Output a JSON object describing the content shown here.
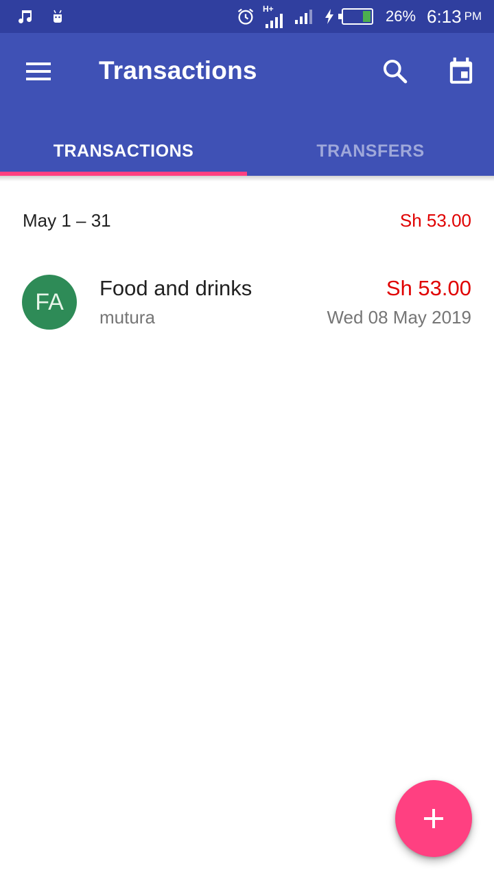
{
  "status_bar": {
    "battery_percent": "26%",
    "battery_level": 0.26,
    "time": "6:13",
    "ampm": "PM",
    "network_type": "H+",
    "icons": [
      "music-note-icon",
      "android-icon",
      "alarm-icon",
      "signal-icon",
      "signal-icon",
      "charging-icon",
      "battery-icon"
    ]
  },
  "app_bar": {
    "title": "Transactions",
    "icons": [
      "menu-icon",
      "search-icon",
      "calendar-icon"
    ]
  },
  "tabs": [
    {
      "label": "TRANSACTIONS",
      "active": true
    },
    {
      "label": "TRANSFERS",
      "active": false
    }
  ],
  "period": {
    "label": "May 1 – 31",
    "total": "Sh 53.00"
  },
  "transactions": [
    {
      "avatar_initials": "FA",
      "category": "Food and drinks",
      "note": "mutura",
      "amount": "Sh 53.00",
      "date": "Wed 08 May 2019"
    }
  ],
  "fab": {
    "icon": "plus-icon"
  },
  "colors": {
    "status_bar": "#303f9f",
    "primary": "#3f51b5",
    "accent": "#ff4081",
    "expense": "#e00000",
    "avatar": "#2e8b57",
    "tab_inactive": "#9fa8da"
  }
}
